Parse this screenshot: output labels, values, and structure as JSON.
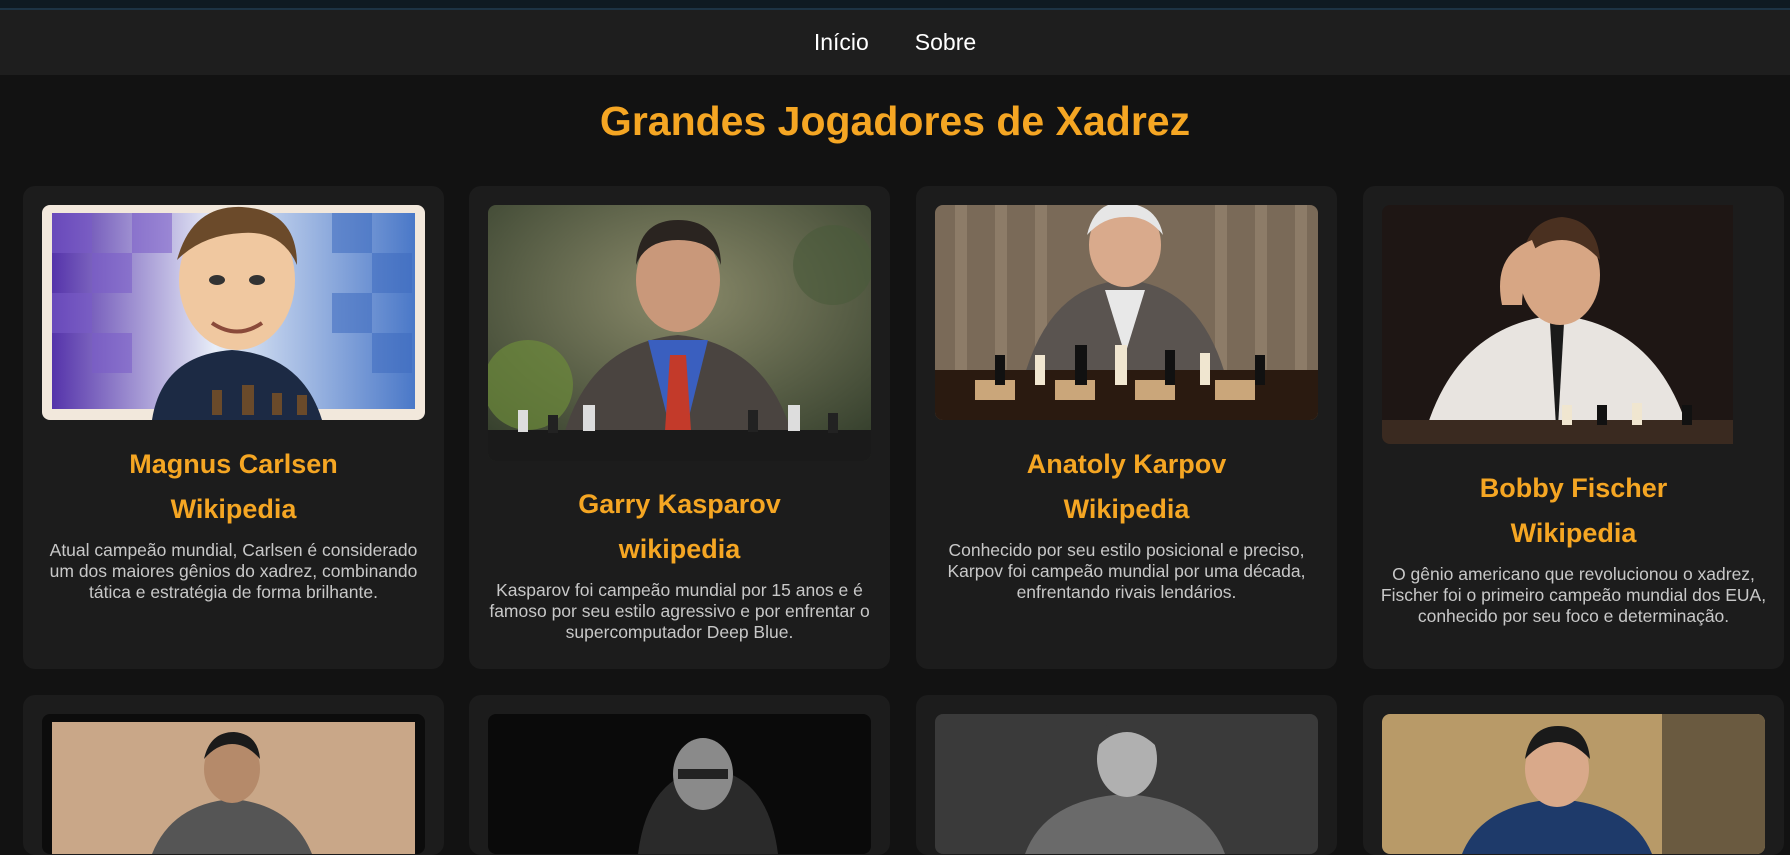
{
  "nav": {
    "items": [
      "Início",
      "Sobre"
    ]
  },
  "page": {
    "title": "Grandes Jogadores de Xadrez"
  },
  "players": [
    {
      "name": "Magnus Carlsen",
      "link": "Wikipedia",
      "description": "Atual campeão mundial, Carlsen é considerado um dos maiores gênios do xadrez, combinando tática e estratégia de forma brilhante.",
      "image_label": "magnus-carlsen-caricature"
    },
    {
      "name": "Garry Kasparov",
      "link": "wikipedia",
      "description": "Kasparov foi campeão mundial por 15 anos e é famoso por seu estilo agressivo e por enfrentar o supercomputador Deep Blue.",
      "image_label": "garry-kasparov-photo"
    },
    {
      "name": "Anatoly Karpov",
      "link": "Wikipedia",
      "description": "Conhecido por seu estilo posicional e preciso, Karpov foi campeão mundial por uma década, enfrentando rivais lendários.",
      "image_label": "anatoly-karpov-photo"
    },
    {
      "name": "Bobby Fischer",
      "link": "Wikipedia",
      "description": "O gênio americano que revolucionou o xadrez, Fischer foi o primeiro campeão mundial dos EUA, conhecido por seu foco e determinação.",
      "image_label": "bobby-fischer-photo"
    }
  ],
  "colors": {
    "accent": "#f5a623",
    "background": "#121212",
    "card": "#1c1c1c",
    "navbar": "#1e1e1e"
  }
}
